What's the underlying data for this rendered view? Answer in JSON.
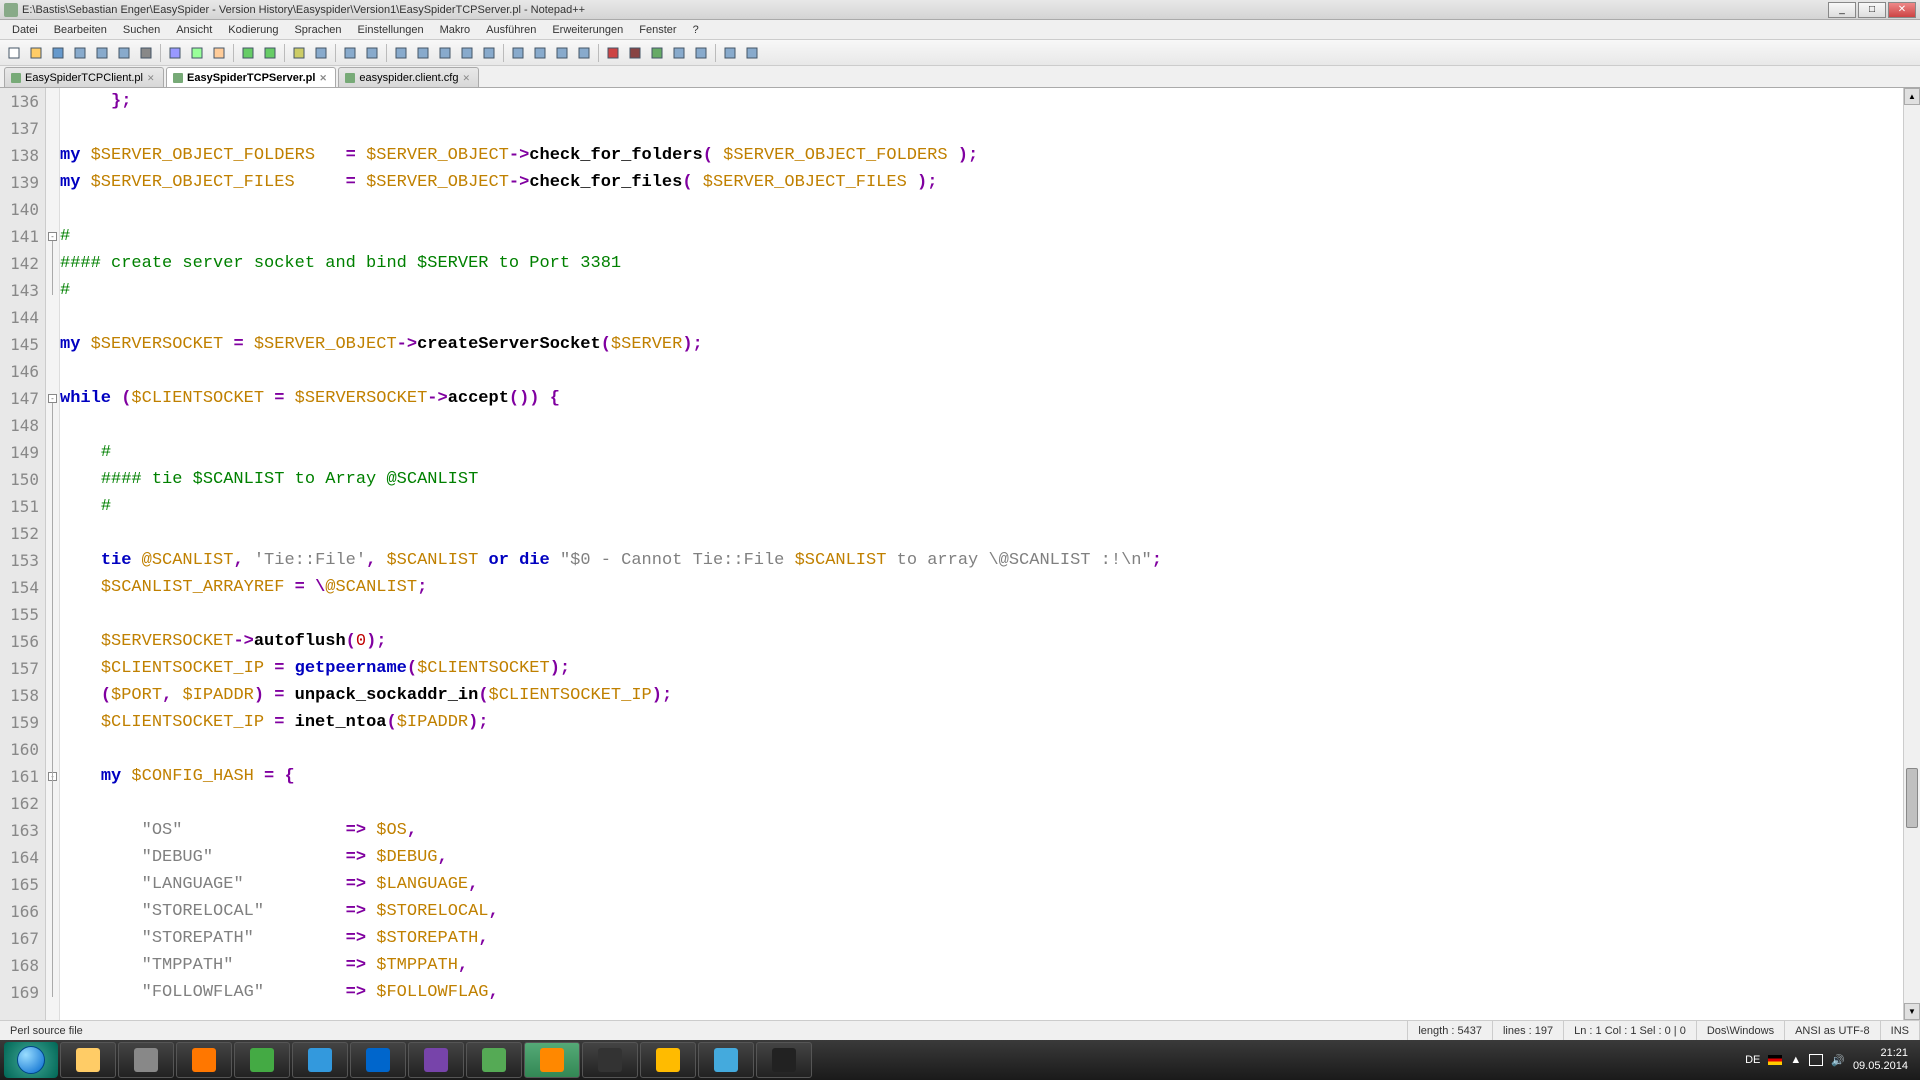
{
  "title": "E:\\Bastis\\Sebastian Enger\\EasySpider - Version History\\Easyspider\\Version1\\EasySpiderTCPServer.pl - Notepad++",
  "menu": [
    "Datei",
    "Bearbeiten",
    "Suchen",
    "Ansicht",
    "Kodierung",
    "Sprachen",
    "Einstellungen",
    "Makro",
    "Ausführen",
    "Erweiterungen",
    "Fenster",
    "?"
  ],
  "tabs": [
    {
      "label": "EasySpiderTCPClient.pl",
      "active": false
    },
    {
      "label": "EasySpiderTCPServer.pl",
      "active": true
    },
    {
      "label": "easyspider.client.cfg",
      "active": false
    }
  ],
  "win_buttons": {
    "min": "_",
    "max": "□",
    "close": "✕"
  },
  "line_start": 136,
  "line_end": 169,
  "status": {
    "filetype": "Perl source file",
    "length": "length : 5437",
    "lines": "lines : 197",
    "pos": "Ln : 1   Col : 1   Sel : 0 | 0",
    "eol": "Dos\\Windows",
    "enc": "ANSI as UTF-8",
    "ins": "INS"
  },
  "tray": {
    "lang": "DE",
    "time": "21:21",
    "date": "09.05.2014"
  },
  "code_lines": [
    {
      "n": 136,
      "tokens": [
        [
          "",
          "     "
        ],
        [
          "punct",
          "};"
        ]
      ]
    },
    {
      "n": 137,
      "tokens": [
        [
          "",
          ""
        ]
      ]
    },
    {
      "n": 138,
      "tokens": [
        [
          "kw",
          "my"
        ],
        [
          "",
          " "
        ],
        [
          "var",
          "$SERVER_OBJECT_FOLDERS"
        ],
        [
          "",
          "   "
        ],
        [
          "punct",
          "="
        ],
        [
          "",
          " "
        ],
        [
          "var",
          "$SERVER_OBJECT"
        ],
        [
          "op",
          "->"
        ],
        [
          "func",
          "check_for_folders"
        ],
        [
          "punct",
          "("
        ],
        [
          "",
          " "
        ],
        [
          "var",
          "$SERVER_OBJECT_FOLDERS"
        ],
        [
          "",
          " "
        ],
        [
          "punct",
          ");"
        ]
      ]
    },
    {
      "n": 139,
      "tokens": [
        [
          "kw",
          "my"
        ],
        [
          "",
          " "
        ],
        [
          "var",
          "$SERVER_OBJECT_FILES"
        ],
        [
          "",
          "     "
        ],
        [
          "punct",
          "="
        ],
        [
          "",
          " "
        ],
        [
          "var",
          "$SERVER_OBJECT"
        ],
        [
          "op",
          "->"
        ],
        [
          "func",
          "check_for_files"
        ],
        [
          "punct",
          "("
        ],
        [
          "",
          " "
        ],
        [
          "var",
          "$SERVER_OBJECT_FILES"
        ],
        [
          "",
          " "
        ],
        [
          "punct",
          ");"
        ]
      ]
    },
    {
      "n": 140,
      "tokens": [
        [
          "",
          ""
        ]
      ]
    },
    {
      "n": 141,
      "tokens": [
        [
          "cmt",
          "#"
        ]
      ]
    },
    {
      "n": 142,
      "tokens": [
        [
          "cmt",
          "#### create server socket and bind $SERVER to Port 3381"
        ]
      ]
    },
    {
      "n": 143,
      "tokens": [
        [
          "cmt",
          "#"
        ]
      ]
    },
    {
      "n": 144,
      "tokens": [
        [
          "",
          ""
        ]
      ]
    },
    {
      "n": 145,
      "tokens": [
        [
          "kw",
          "my"
        ],
        [
          "",
          " "
        ],
        [
          "var",
          "$SERVERSOCKET"
        ],
        [
          "",
          " "
        ],
        [
          "punct",
          "="
        ],
        [
          "",
          " "
        ],
        [
          "var",
          "$SERVER_OBJECT"
        ],
        [
          "op",
          "->"
        ],
        [
          "func",
          "createServerSocket"
        ],
        [
          "punct",
          "("
        ],
        [
          "var",
          "$SERVER"
        ],
        [
          "punct",
          ");"
        ]
      ]
    },
    {
      "n": 146,
      "tokens": [
        [
          "",
          ""
        ]
      ]
    },
    {
      "n": 147,
      "tokens": [
        [
          "kw",
          "while"
        ],
        [
          "",
          " "
        ],
        [
          "punct",
          "("
        ],
        [
          "var",
          "$CLIENTSOCKET"
        ],
        [
          "",
          " "
        ],
        [
          "punct",
          "="
        ],
        [
          "",
          " "
        ],
        [
          "var",
          "$SERVERSOCKET"
        ],
        [
          "op",
          "->"
        ],
        [
          "func",
          "accept"
        ],
        [
          "punct",
          "())"
        ],
        [
          "",
          " "
        ],
        [
          "punct",
          "{"
        ]
      ]
    },
    {
      "n": 148,
      "tokens": [
        [
          "",
          ""
        ]
      ]
    },
    {
      "n": 149,
      "tokens": [
        [
          "",
          "    "
        ],
        [
          "cmt",
          "#"
        ]
      ]
    },
    {
      "n": 150,
      "tokens": [
        [
          "",
          "    "
        ],
        [
          "cmt",
          "#### tie $SCANLIST to Array @SCANLIST"
        ]
      ]
    },
    {
      "n": 151,
      "tokens": [
        [
          "",
          "    "
        ],
        [
          "cmt",
          "#"
        ]
      ]
    },
    {
      "n": 152,
      "tokens": [
        [
          "",
          "    "
        ]
      ]
    },
    {
      "n": 153,
      "tokens": [
        [
          "",
          "    "
        ],
        [
          "kw",
          "tie"
        ],
        [
          "",
          " "
        ],
        [
          "var",
          "@SCANLIST"
        ],
        [
          "punct",
          ","
        ],
        [
          "",
          " "
        ],
        [
          "str",
          "'Tie::File'"
        ],
        [
          "punct",
          ","
        ],
        [
          "",
          " "
        ],
        [
          "var",
          "$SCANLIST"
        ],
        [
          "",
          " "
        ],
        [
          "kw",
          "or"
        ],
        [
          "",
          " "
        ],
        [
          "kw",
          "die"
        ],
        [
          "",
          " "
        ],
        [
          "str2",
          "\"$0"
        ],
        [
          "str",
          " - Cannot Tie::File "
        ],
        [
          "var",
          "$SCANLIST"
        ],
        [
          "str",
          " to array "
        ],
        [
          "str",
          "\\@SCANLIST :!\\n\""
        ],
        [
          "punct",
          ";"
        ]
      ]
    },
    {
      "n": 154,
      "tokens": [
        [
          "",
          "    "
        ],
        [
          "var",
          "$SCANLIST_ARRAYREF"
        ],
        [
          "",
          " "
        ],
        [
          "punct",
          "="
        ],
        [
          "",
          " "
        ],
        [
          "punct",
          "\\"
        ],
        [
          "var",
          "@SCANLIST"
        ],
        [
          "punct",
          ";"
        ]
      ]
    },
    {
      "n": 155,
      "tokens": [
        [
          "",
          ""
        ]
      ]
    },
    {
      "n": 156,
      "tokens": [
        [
          "",
          "    "
        ],
        [
          "var",
          "$SERVERSOCKET"
        ],
        [
          "op",
          "->"
        ],
        [
          "func",
          "autoflush"
        ],
        [
          "punct",
          "("
        ],
        [
          "num",
          "0"
        ],
        [
          "punct",
          ");"
        ]
      ]
    },
    {
      "n": 157,
      "tokens": [
        [
          "",
          "    "
        ],
        [
          "var",
          "$CLIENTSOCKET_IP"
        ],
        [
          "",
          " "
        ],
        [
          "punct",
          "="
        ],
        [
          "",
          " "
        ],
        [
          "kw",
          "getpeername"
        ],
        [
          "punct",
          "("
        ],
        [
          "var",
          "$CLIENTSOCKET"
        ],
        [
          "punct",
          ");"
        ]
      ]
    },
    {
      "n": 158,
      "tokens": [
        [
          "",
          "    "
        ],
        [
          "punct",
          "("
        ],
        [
          "var",
          "$PORT"
        ],
        [
          "punct",
          ","
        ],
        [
          "",
          " "
        ],
        [
          "var",
          "$IPADDR"
        ],
        [
          "punct",
          ")"
        ],
        [
          "",
          " "
        ],
        [
          "punct",
          "="
        ],
        [
          "",
          " "
        ],
        [
          "func",
          "unpack_sockaddr_in"
        ],
        [
          "punct",
          "("
        ],
        [
          "var",
          "$CLIENTSOCKET_IP"
        ],
        [
          "punct",
          ");"
        ]
      ]
    },
    {
      "n": 159,
      "tokens": [
        [
          "",
          "    "
        ],
        [
          "var",
          "$CLIENTSOCKET_IP"
        ],
        [
          "",
          " "
        ],
        [
          "punct",
          "="
        ],
        [
          "",
          " "
        ],
        [
          "func",
          "inet_ntoa"
        ],
        [
          "punct",
          "("
        ],
        [
          "var",
          "$IPADDR"
        ],
        [
          "punct",
          ");"
        ]
      ]
    },
    {
      "n": 160,
      "tokens": [
        [
          "",
          ""
        ]
      ]
    },
    {
      "n": 161,
      "tokens": [
        [
          "",
          "    "
        ],
        [
          "kw",
          "my"
        ],
        [
          "",
          " "
        ],
        [
          "var",
          "$CONFIG_HASH"
        ],
        [
          "",
          " "
        ],
        [
          "punct",
          "="
        ],
        [
          "",
          " "
        ],
        [
          "punct",
          "{"
        ]
      ]
    },
    {
      "n": 162,
      "tokens": [
        [
          "",
          ""
        ]
      ]
    },
    {
      "n": 163,
      "tokens": [
        [
          "",
          "        "
        ],
        [
          "str",
          "\"OS\""
        ],
        [
          "",
          "                "
        ],
        [
          "punct",
          "=>"
        ],
        [
          "",
          " "
        ],
        [
          "var",
          "$OS"
        ],
        [
          "punct",
          ","
        ]
      ]
    },
    {
      "n": 164,
      "tokens": [
        [
          "",
          "        "
        ],
        [
          "str",
          "\"DEBUG\""
        ],
        [
          "",
          "             "
        ],
        [
          "punct",
          "=>"
        ],
        [
          "",
          " "
        ],
        [
          "var",
          "$DEBUG"
        ],
        [
          "punct",
          ","
        ]
      ]
    },
    {
      "n": 165,
      "tokens": [
        [
          "",
          "        "
        ],
        [
          "str",
          "\"LANGUAGE\""
        ],
        [
          "",
          "          "
        ],
        [
          "punct",
          "=>"
        ],
        [
          "",
          " "
        ],
        [
          "var",
          "$LANGUAGE"
        ],
        [
          "punct",
          ","
        ]
      ]
    },
    {
      "n": 166,
      "tokens": [
        [
          "",
          "        "
        ],
        [
          "str",
          "\"STORELOCAL\""
        ],
        [
          "",
          "        "
        ],
        [
          "punct",
          "=>"
        ],
        [
          "",
          " "
        ],
        [
          "var",
          "$STORELOCAL"
        ],
        [
          "punct",
          ","
        ]
      ]
    },
    {
      "n": 167,
      "tokens": [
        [
          "",
          "        "
        ],
        [
          "str",
          "\"STOREPATH\""
        ],
        [
          "",
          "         "
        ],
        [
          "punct",
          "=>"
        ],
        [
          "",
          " "
        ],
        [
          "var",
          "$STOREPATH"
        ],
        [
          "punct",
          ","
        ]
      ]
    },
    {
      "n": 168,
      "tokens": [
        [
          "",
          "        "
        ],
        [
          "str",
          "\"TMPPATH\""
        ],
        [
          "",
          "           "
        ],
        [
          "punct",
          "=>"
        ],
        [
          "",
          " "
        ],
        [
          "var",
          "$TMPPATH"
        ],
        [
          "punct",
          ","
        ]
      ]
    },
    {
      "n": 169,
      "tokens": [
        [
          "",
          "        "
        ],
        [
          "str",
          "\"FOLLOWFLAG\""
        ],
        [
          "",
          "        "
        ],
        [
          "punct",
          "=>"
        ],
        [
          "",
          " "
        ],
        [
          "var",
          "$FOLLOWFLAG"
        ],
        [
          "punct",
          ","
        ]
      ]
    }
  ],
  "fold_marks": [
    {
      "line": 141,
      "sym": "-"
    },
    {
      "line": 147,
      "sym": "-"
    },
    {
      "line": 161,
      "sym": "-"
    }
  ],
  "taskbar_apps": [
    "explorer",
    "server",
    "firefox",
    "chrome",
    "ie",
    "search",
    "eclipse",
    "shield",
    "xampp",
    "bat",
    "mysql",
    "cube",
    "terminal"
  ]
}
